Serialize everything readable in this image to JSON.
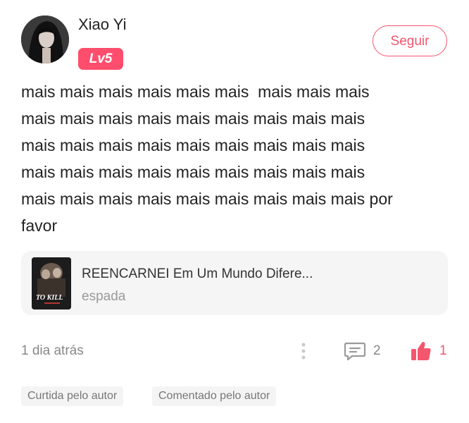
{
  "user": {
    "name": "Xiao Yi",
    "level": "Lv5"
  },
  "follow_button": "Seguir",
  "post": {
    "text": "mais mais mais mais mais mais  mais mais mais\nmais mais mais mais mais mais mais mais mais\nmais mais mais mais mais mais mais mais mais\nmais mais mais mais mais mais mais mais mais\nmais mais mais mais mais mais mais mais mais por\nfavor"
  },
  "book": {
    "title": "REENCARNEI Em Um Mundo Difere...",
    "tag": "espada",
    "cover_text": "TO KILL"
  },
  "meta": {
    "time": "1 dia atrás",
    "comment_count": "2",
    "like_count": "1"
  },
  "badges": [
    "Curtida pelo autor",
    "Comentado pelo autor"
  ],
  "colors": {
    "accent": "#f4566e",
    "level_bg": "#ff4d6d"
  },
  "icons": {
    "more": "more-vertical-icon",
    "comment": "comment-icon",
    "like": "thumbs-up-icon"
  }
}
